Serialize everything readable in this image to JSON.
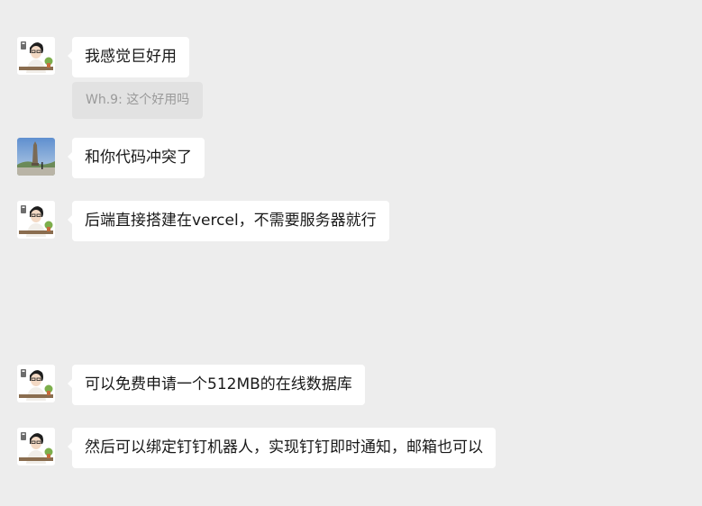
{
  "colors": {
    "background": "#ededed",
    "bubble": "#ffffff",
    "quote_background": "#e2e2e2",
    "quote_text": "#9a9a9a"
  },
  "messages": [
    {
      "avatar": "cartoon-man-avatar-icon",
      "text": "我感觉巨好用"
    },
    {
      "avatar": "landscape-photo-avatar-icon",
      "text": "和你代码冲突了"
    },
    {
      "avatar": "cartoon-man-avatar-icon",
      "text": "后端直接搭建在vercel，不需要服务器就行"
    },
    {
      "avatar": "cartoon-man-avatar-icon",
      "text": "可以免费申请一个512MB的在线数据库"
    },
    {
      "avatar": "cartoon-man-avatar-icon",
      "text": "然后可以绑定钉钉机器人，实现钉钉即时通知，邮箱也可以"
    }
  ],
  "quote": {
    "text": "Wh.9: 这个好用吗"
  }
}
